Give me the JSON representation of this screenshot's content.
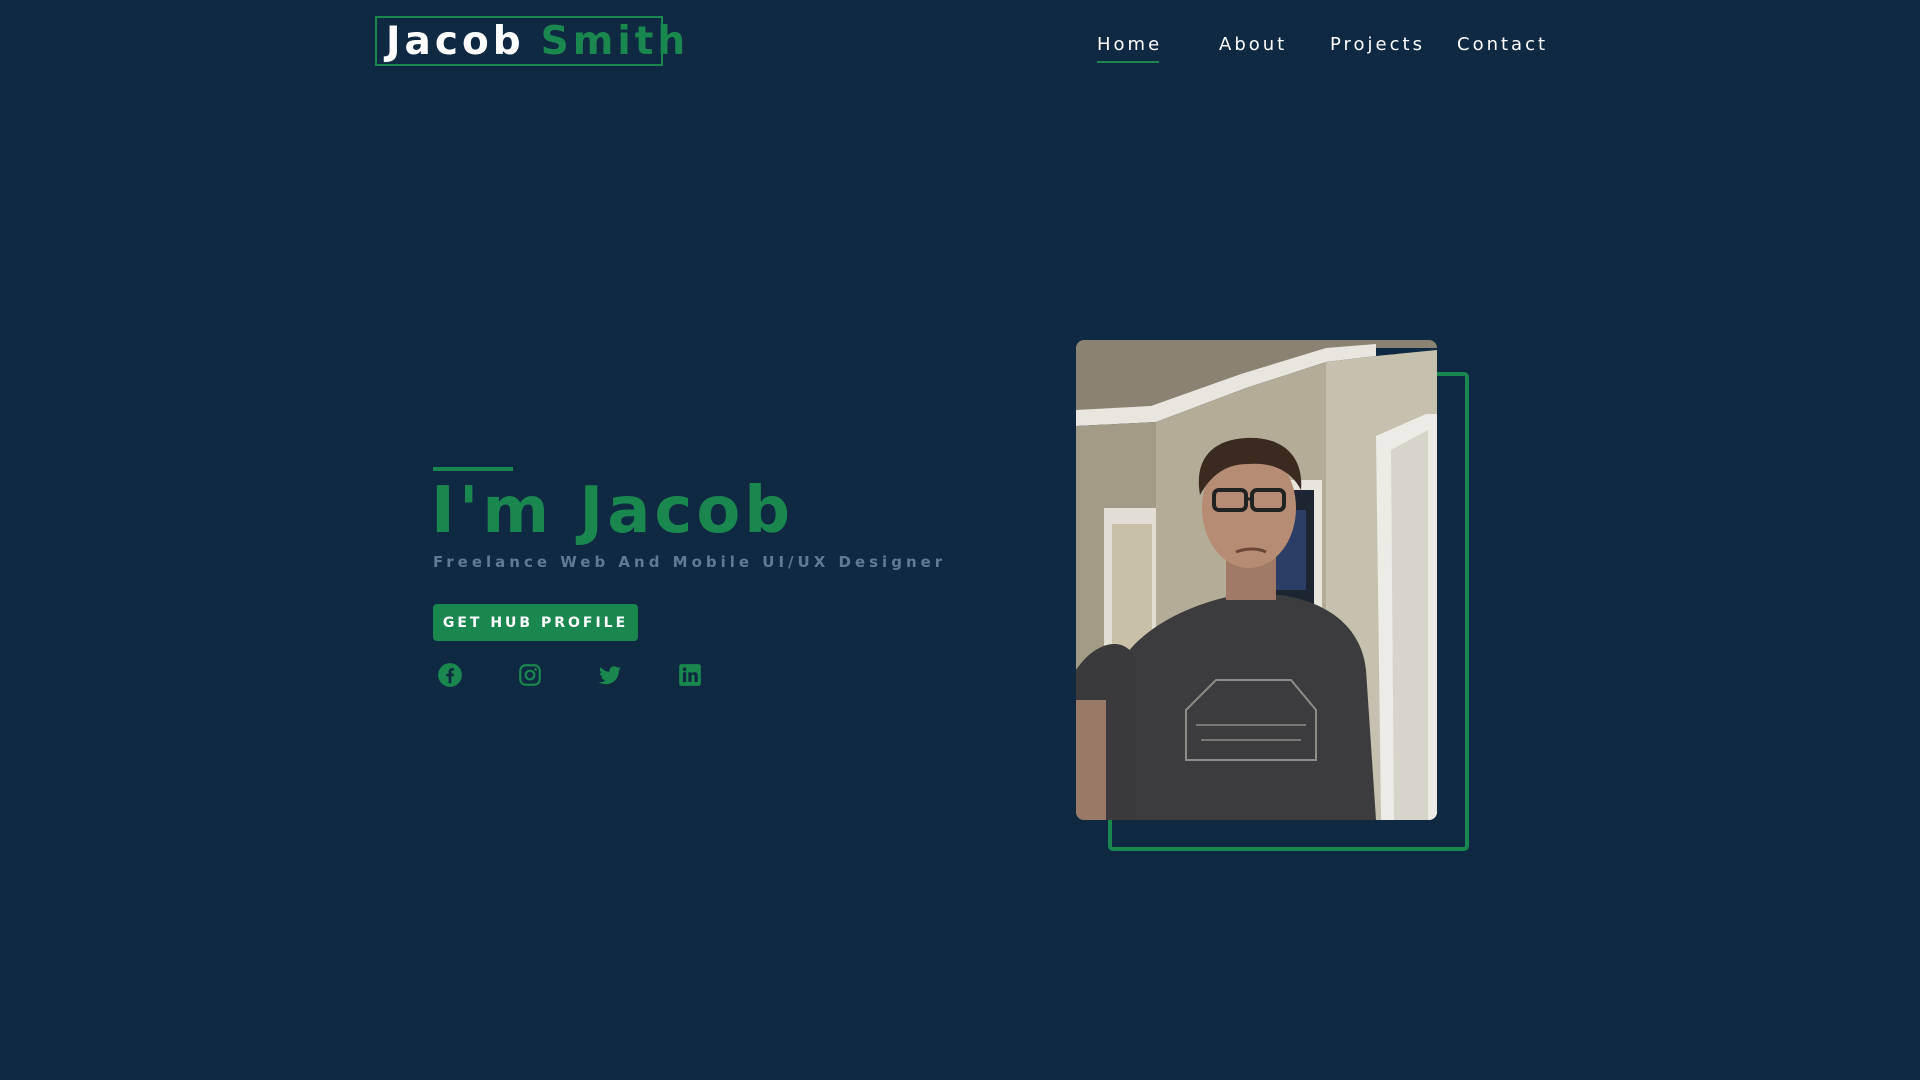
{
  "header": {
    "logo_first": "Jacob",
    "logo_last": "Smith",
    "nav": [
      {
        "label": "Home",
        "active": true
      },
      {
        "label": "About",
        "active": false
      },
      {
        "label": "Projects",
        "active": false
      },
      {
        "label": "Contact",
        "active": false
      }
    ]
  },
  "hero": {
    "title": "I'm Jacob",
    "subtitle": "Freelance Web And Mobile UI/UX Designer",
    "cta_label": "GET HUB PROFILE",
    "social_icons": [
      "facebook-icon",
      "instagram-icon",
      "twitter-icon",
      "linkedin-icon"
    ]
  },
  "colors": {
    "background": "#0f2942",
    "accent": "#1a874f",
    "subtitle": "#5f7a92",
    "text": "#ffffff"
  }
}
